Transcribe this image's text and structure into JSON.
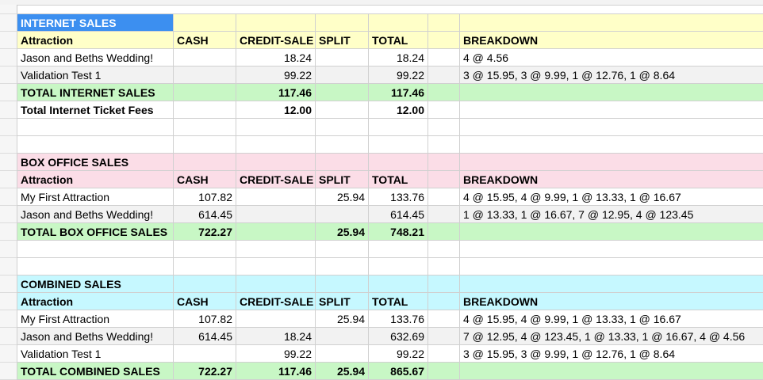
{
  "columns": [
    "Attraction",
    "CASH",
    "CREDIT-SALE",
    "SPLIT",
    "TOTAL",
    "",
    "BREAKDOWN"
  ],
  "rows": [
    {
      "type": "section",
      "color": "yellow",
      "cells": [
        "INTERNET SALES",
        "",
        "",
        "",
        "",
        "",
        ""
      ]
    },
    {
      "type": "header",
      "color": "yellow",
      "cells": [
        "Attraction",
        "CASH",
        "CREDIT-SALE",
        "SPLIT",
        "TOTAL",
        "",
        "BREAKDOWN"
      ]
    },
    {
      "type": "data",
      "cells": [
        "Jason and Beths Wedding!",
        "",
        "18.24",
        "",
        "18.24",
        "",
        "4 @ 4.56"
      ]
    },
    {
      "type": "data",
      "cells": [
        "Validation Test 1",
        "",
        "99.22",
        "",
        "99.22",
        "",
        "3 @ 15.95, 3 @ 9.99, 1 @ 12.76, 1 @ 8.64"
      ]
    },
    {
      "type": "total",
      "color": "green",
      "cells": [
        "TOTAL INTERNET SALES",
        "",
        "117.46",
        "",
        "117.46",
        "",
        ""
      ]
    },
    {
      "type": "fees",
      "cells": [
        "Total Internet Ticket Fees",
        "",
        "12.00",
        "",
        "12.00",
        "",
        ""
      ]
    },
    {
      "type": "blank",
      "cells": [
        "",
        "",
        "",
        "",
        "",
        "",
        ""
      ]
    },
    {
      "type": "blank",
      "cells": [
        "",
        "",
        "",
        "",
        "",
        "",
        ""
      ]
    },
    {
      "type": "section",
      "color": "pink",
      "cells": [
        "BOX OFFICE SALES",
        "",
        "",
        "",
        "",
        "",
        ""
      ]
    },
    {
      "type": "header",
      "color": "pink",
      "cells": [
        "Attraction",
        "CASH",
        "CREDIT-SALE",
        "SPLIT",
        "TOTAL",
        "",
        "BREAKDOWN"
      ]
    },
    {
      "type": "data",
      "cells": [
        "My First Attraction",
        "107.82",
        "",
        "25.94",
        "133.76",
        "",
        "4 @ 15.95, 4 @ 9.99, 1 @ 13.33, 1 @ 16.67"
      ]
    },
    {
      "type": "data",
      "cells": [
        "Jason and Beths Wedding!",
        "614.45",
        "",
        "",
        "614.45",
        "",
        "1 @ 13.33, 1 @ 16.67, 7 @ 12.95, 4 @ 123.45"
      ]
    },
    {
      "type": "total",
      "color": "green",
      "cells": [
        "TOTAL BOX OFFICE SALES",
        "722.27",
        "",
        "25.94",
        "748.21",
        "",
        ""
      ]
    },
    {
      "type": "blank",
      "cells": [
        "",
        "",
        "",
        "",
        "",
        "",
        ""
      ]
    },
    {
      "type": "blank",
      "cells": [
        "",
        "",
        "",
        "",
        "",
        "",
        ""
      ]
    },
    {
      "type": "section",
      "color": "cyan",
      "cells": [
        "COMBINED SALES",
        "",
        "",
        "",
        "",
        "",
        ""
      ]
    },
    {
      "type": "header",
      "color": "cyan",
      "cells": [
        "Attraction",
        "CASH",
        "CREDIT-SALE",
        "SPLIT",
        "TOTAL",
        "",
        "BREAKDOWN"
      ]
    },
    {
      "type": "data",
      "cells": [
        "My First Attraction",
        "107.82",
        "",
        "25.94",
        "133.76",
        "",
        "4 @ 15.95, 4 @ 9.99, 1 @ 13.33, 1 @ 16.67"
      ]
    },
    {
      "type": "data",
      "cells": [
        "Jason and Beths Wedding!",
        "614.45",
        "18.24",
        "",
        "632.69",
        "",
        "7 @ 12.95, 4 @ 123.45, 1 @ 13.33, 1 @ 16.67, 4 @ 4.56"
      ]
    },
    {
      "type": "data",
      "cells": [
        "Validation Test 1",
        "",
        "99.22",
        "",
        "99.22",
        "",
        "3 @ 15.95, 3 @ 9.99, 1 @ 12.76, 1 @ 8.64"
      ]
    },
    {
      "type": "total",
      "color": "green",
      "cells": [
        "TOTAL COMBINED SALES",
        "722.27",
        "117.46",
        "25.94",
        "865.67",
        "",
        ""
      ]
    }
  ],
  "selected_cell": "INTERNET SALES",
  "colors": {
    "selection": "#3c8ff0",
    "yellow": "#ffffc8",
    "pink": "#fbdde7",
    "cyan": "#c6f8ff",
    "green": "#c8f7c5",
    "alt": "#f2f2f2"
  }
}
